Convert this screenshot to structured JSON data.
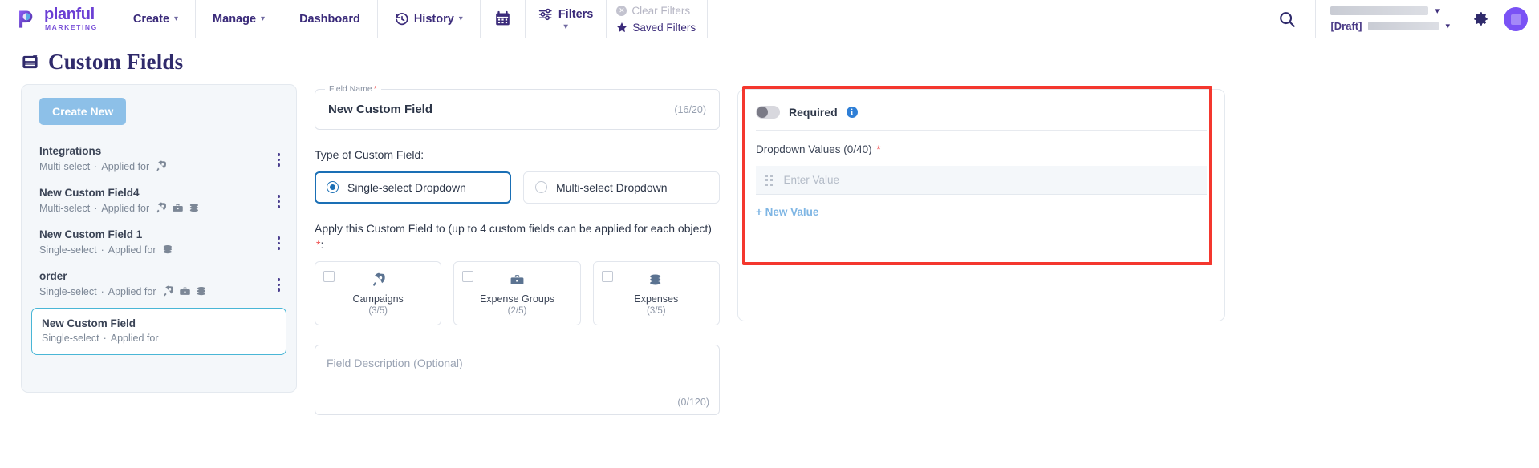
{
  "brand": {
    "name": "planful",
    "sub": "MARKETING",
    "logo_icon": "planful-logo"
  },
  "nav": {
    "items": [
      {
        "label": "Create",
        "has_caret": true,
        "icon": null
      },
      {
        "label": "Manage",
        "has_caret": true,
        "icon": null
      },
      {
        "label": "Dashboard",
        "has_caret": false,
        "icon": null
      },
      {
        "label": "History",
        "has_caret": true,
        "icon": "history-icon"
      }
    ],
    "calendar_icon": "calendar-icon",
    "filters": {
      "label": "Filters",
      "icon": "filters-icon"
    },
    "clear_filters": {
      "label": "Clear Filters",
      "icon": "close-circle-icon",
      "disabled": true
    },
    "saved_filters": {
      "label": "Saved Filters",
      "icon": "star-icon"
    }
  },
  "header_right": {
    "search_icon": "search-icon",
    "scenario_value": "",
    "draft_tag": "[Draft]",
    "draft_value": "",
    "gear_icon": "gear-icon",
    "avatar_icon": "avatar",
    "accent_purple": "#7a52f5"
  },
  "page": {
    "title": "Custom Fields",
    "title_icon": "custom-fields-icon"
  },
  "list_panel": {
    "create_button": "Create New",
    "items": [
      {
        "name": "Integrations",
        "type": "Multi-select",
        "applied_label": "Applied for",
        "icons": [
          "rocket-icon"
        ],
        "selected": false,
        "menu_icon": "kebab-menu-icon"
      },
      {
        "name": "New Custom Field4",
        "type": "Multi-select",
        "applied_label": "Applied for",
        "icons": [
          "rocket-icon",
          "briefcase-icon",
          "coins-icon"
        ],
        "selected": false,
        "menu_icon": "kebab-menu-icon"
      },
      {
        "name": "New Custom Field 1",
        "type": "Single-select",
        "applied_label": "Applied for",
        "icons": [
          "coins-icon"
        ],
        "selected": false,
        "menu_icon": "kebab-menu-icon"
      },
      {
        "name": "order",
        "type": "Single-select",
        "applied_label": "Applied for",
        "icons": [
          "rocket-icon",
          "briefcase-icon",
          "coins-icon"
        ],
        "selected": false,
        "menu_icon": "kebab-menu-icon"
      },
      {
        "name": "New Custom Field",
        "type": "Single-select",
        "applied_label": "Applied for",
        "icons": [],
        "selected": true,
        "menu_icon": null
      }
    ],
    "separator": "·"
  },
  "form": {
    "field_name": {
      "legend": "Field Name",
      "required": true,
      "value": "New Custom Field",
      "counter": "(16/20)"
    },
    "type_label": "Type of Custom Field:",
    "type_options": [
      {
        "label": "Single-select Dropdown",
        "checked": true
      },
      {
        "label": "Multi-select Dropdown",
        "checked": false
      }
    ],
    "apply_label": "Apply this Custom Field to (up to 4 custom fields can be applied for each object)",
    "apply_required": "*",
    "apply_colon": ":",
    "objects": [
      {
        "name": "Campaigns",
        "count": "(3/5)",
        "icon": "rocket-icon",
        "checked": false
      },
      {
        "name": "Expense Groups",
        "count": "(2/5)",
        "icon": "briefcase-icon",
        "checked": false
      },
      {
        "name": "Expenses",
        "count": "(3/5)",
        "icon": "coins-icon",
        "checked": false
      }
    ],
    "description": {
      "placeholder": "Field Description (Optional)",
      "value": "",
      "counter": "(0/120)"
    }
  },
  "right_panel": {
    "required_toggle": {
      "label": "Required",
      "on": false,
      "info_icon": "info-icon",
      "info_glyph": "i"
    },
    "dropdown_values_label": "Dropdown Values (0/40)",
    "dropdown_values_required": "*",
    "value_rows": [
      {
        "placeholder": "Enter Value",
        "value": "",
        "drag_icon": "drag-handle-icon"
      }
    ],
    "new_value_link": "+ New Value",
    "highlight_color": "#f4372e"
  }
}
